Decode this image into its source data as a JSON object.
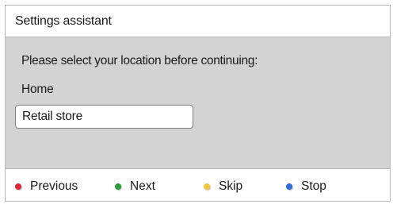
{
  "window": {
    "title": "Settings assistant"
  },
  "content": {
    "prompt": "Please select your location before continuing:",
    "options": [
      {
        "label": "Home",
        "selected": false
      },
      {
        "label": "Retail store",
        "selected": true
      }
    ]
  },
  "buttons": [
    {
      "label": "Previous",
      "color": "#e0283a",
      "icon": "red-dot-icon"
    },
    {
      "label": "Next",
      "color": "#2a9d3c",
      "icon": "green-dot-icon"
    },
    {
      "label": "Skip",
      "color": "#f2c53d",
      "icon": "yellow-dot-icon"
    },
    {
      "label": "Stop",
      "color": "#2c6fd6",
      "icon": "blue-dot-icon"
    }
  ]
}
